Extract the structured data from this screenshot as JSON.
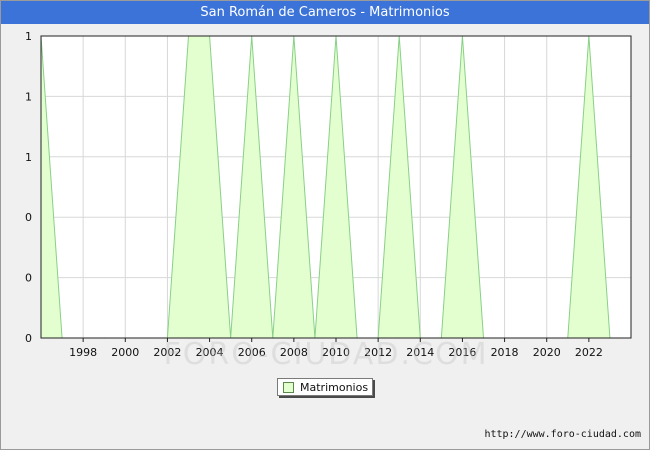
{
  "header": {
    "title": "San Román de Cameros - Matrimonios"
  },
  "footer": {
    "source": "http://www.foro-ciudad.com"
  },
  "watermark": "FORO-CIUDAD.COM",
  "colors": {
    "header_bg": "#3b73d9",
    "fill": "#e4ffcf",
    "line": "#88d088",
    "plot_bg": "#ffffff",
    "grid": "#d8d8d8"
  },
  "chart_data": {
    "type": "area",
    "title": "San Román de Cameros - Matrimonios",
    "xlabel": "",
    "ylabel": "",
    "x": [
      1996,
      1997,
      1998,
      1999,
      2000,
      2001,
      2002,
      2003,
      2004,
      2005,
      2006,
      2007,
      2008,
      2009,
      2010,
      2011,
      2012,
      2013,
      2014,
      2015,
      2016,
      2017,
      2018,
      2019,
      2020,
      2021,
      2022,
      2023
    ],
    "series": [
      {
        "name": "Matrimonios",
        "values": [
          1,
          0,
          0,
          0,
          0,
          0,
          0,
          1,
          1,
          0,
          1,
          0,
          1,
          0,
          1,
          0,
          0,
          1,
          0,
          0,
          1,
          0,
          0,
          0,
          0,
          0,
          1,
          0
        ]
      }
    ],
    "xlim": [
      1996,
      2024
    ],
    "ylim": [
      0,
      1
    ],
    "x_ticks": [
      1998,
      2000,
      2002,
      2004,
      2006,
      2008,
      2010,
      2012,
      2014,
      2016,
      2018,
      2020,
      2022
    ],
    "y_tick_labels": [
      "0",
      "0",
      "0",
      "1",
      "1",
      "1"
    ],
    "grid": true,
    "legend": {
      "position": "bottom-center",
      "entries": [
        "Matrimonios"
      ]
    }
  }
}
